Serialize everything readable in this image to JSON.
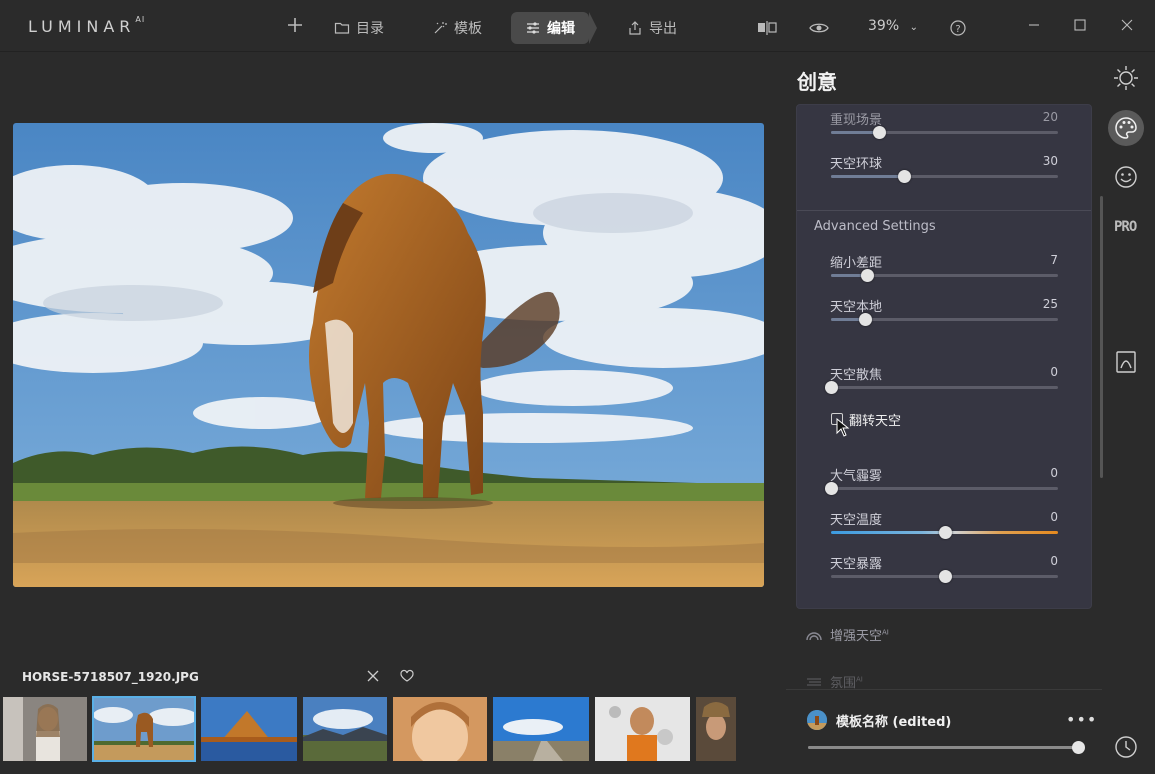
{
  "app": {
    "logo": "LUMINAR",
    "logo_sup": "AI"
  },
  "nav": {
    "catalog": "目录",
    "templates": "模板",
    "edit": "编辑",
    "export": "导出"
  },
  "toolbar": {
    "zoom": "39%"
  },
  "photo": {
    "filename": "HORSE-5718507_1920.JPG"
  },
  "panel": {
    "title": "创意",
    "advanced_label": "Advanced Settings",
    "sliders": [
      {
        "label": "重现场景",
        "value": "20",
        "fraction": 0.21
      },
      {
        "label": "天空环球",
        "value": "30",
        "fraction": 0.32
      },
      {
        "label": "缩小差距",
        "value": "7",
        "fraction": 0.16
      },
      {
        "label": "天空本地",
        "value": "25",
        "fraction": 0.15
      },
      {
        "label": "天空散焦",
        "value": "0",
        "fraction": 0.0
      },
      {
        "label": "大气霾雾",
        "value": "0",
        "fraction": 0.0
      },
      {
        "label": "天空温度",
        "value": "0",
        "fraction": 0.5
      },
      {
        "label": "天空暴露",
        "value": "0",
        "fraction": 0.5
      }
    ],
    "flip_sky": {
      "label": "翻转天空",
      "checked": false
    },
    "sections": [
      {
        "label": "增强天空",
        "sup": "AI"
      },
      {
        "label": "氛围",
        "sup": "AI"
      }
    ]
  },
  "template_footer": {
    "name": "模板名称 (edited)",
    "more": "•••",
    "amount_fraction": 1.0
  },
  "colors": {
    "accent_blue": "#5ab0e6",
    "panel_bg": "#363642",
    "app_bg": "#2b2b2b"
  },
  "icons": [
    "plus-icon",
    "folder-icon",
    "magic-wand-icon",
    "sliders-icon",
    "share-icon",
    "compare-icon",
    "eye-icon",
    "help-icon",
    "minimize-icon",
    "maximize-icon",
    "close-icon",
    "sun-icon",
    "palette-icon",
    "smile-icon",
    "pro-icon",
    "portrait-icon",
    "history-icon",
    "heart-icon",
    "reject-icon"
  ]
}
